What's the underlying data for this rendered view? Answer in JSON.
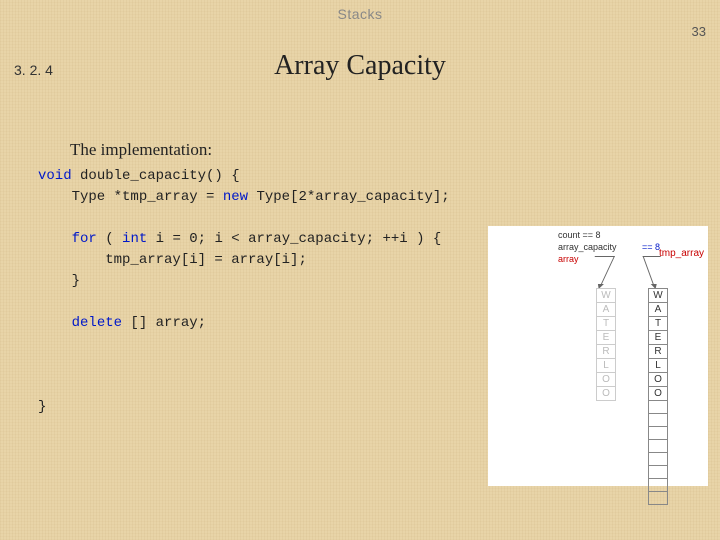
{
  "header": "Stacks",
  "page_number": "33",
  "section_number": "3. 2. 4",
  "title": "Array Capacity",
  "subtitle": "The implementation:",
  "code": {
    "l1a": "void",
    "l1b": " double_capacity() {",
    "l2": "    Type *tmp_array = ",
    "l2b": "new",
    "l2c": " Type[2*array_capacity];",
    "l3a": "    ",
    "l3b": "for",
    "l3c": " ( ",
    "l3d": "int",
    "l3e": " i = 0; i < array_capacity; ++i ) {",
    "l4": "        tmp_array[i] = array[i];",
    "l5": "    }",
    "l6a": "    ",
    "l6b": "delete",
    "l6c": " [] array;",
    "l7": "}"
  },
  "diagram": {
    "count_label": "count == 8",
    "capacity_label": "array_capacity",
    "capacity_value": "== 8",
    "array_label": "array",
    "tmp_label": "tmp_array",
    "left_cells": [
      "W",
      "A",
      "T",
      "E",
      "R",
      "L",
      "O",
      "O"
    ],
    "right_cells": [
      "W",
      "A",
      "T",
      "E",
      "R",
      "L",
      "O",
      "O",
      "",
      "",
      "",
      "",
      "",
      "",
      "",
      ""
    ]
  }
}
